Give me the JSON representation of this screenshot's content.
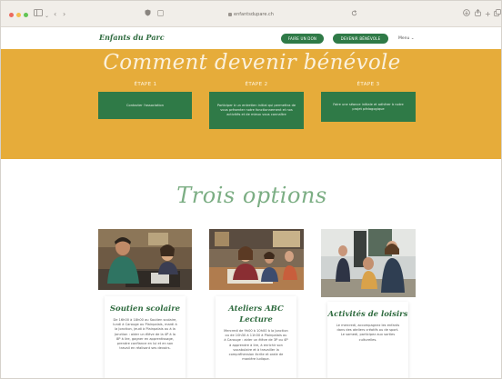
{
  "browser": {
    "address": "enfantsdupare.ch",
    "icons": [
      "sidebar-icon",
      "back-icon",
      "forward-icon",
      "shield-icon",
      "tab-icon",
      "reload-icon",
      "download-icon",
      "share-icon",
      "new-tab-icon",
      "tabs-overview-icon"
    ]
  },
  "header": {
    "logo": "Enfants du Parc",
    "donate_label": "FAIRE UN DON",
    "volunteer_label": "DEVENIR BÉNÉVOLE",
    "menu_label": "Menu ⌄"
  },
  "hero": {
    "title": "Comment devenir bénévole",
    "steps": [
      {
        "label": "ÉTAPE 1",
        "text": "Contacter l'association"
      },
      {
        "label": "ÉTAPE 2",
        "text": "Participer à un entretien initial qui permettra de vous présenter notre fonctionnement et nos activités et de mieux vous connaître"
      },
      {
        "label": "ÉTAPE 3",
        "text": "Faire une séance initiale et adhérer à notre projet pédagogique"
      }
    ]
  },
  "options": {
    "title": "Trois options",
    "cards": [
      {
        "title": "Soutien scolaire",
        "text": "De 16h00 à 18h00 au Soutien scolaire, lundi à Carouge ou Plainpalais, mardi à la Jonction, jeudi à Plainpalais ou à la Jonction : aider un élève de la 4P à la 8P à lire, gagner en apprentissage, prendre confiance en lui et en son travail en réalisant ses devoirs."
      },
      {
        "title": "Ateliers ABC Lecture",
        "text": "Mercredi de 9h00 à 10h00 à la Jonction ou de 10h30 à 11h30 à Plainpalais ou à Carouge : aider un élève de 3P ou 4P à apprendre à lire, à enrichir son vocabulaire et à travailler la compréhension écrite et orale de manière ludique."
      },
      {
        "title": "Activités de loisirs",
        "text": "Le mercredi, accompagnez les enfants dans des ateliers créatifs ou de sport. Le samedi, participez aux sorties culturelles."
      }
    ]
  },
  "colors": {
    "accent_green": "#2f7a47",
    "hero_orange": "#e6ac3a",
    "title_light_green": "#7cae84"
  }
}
